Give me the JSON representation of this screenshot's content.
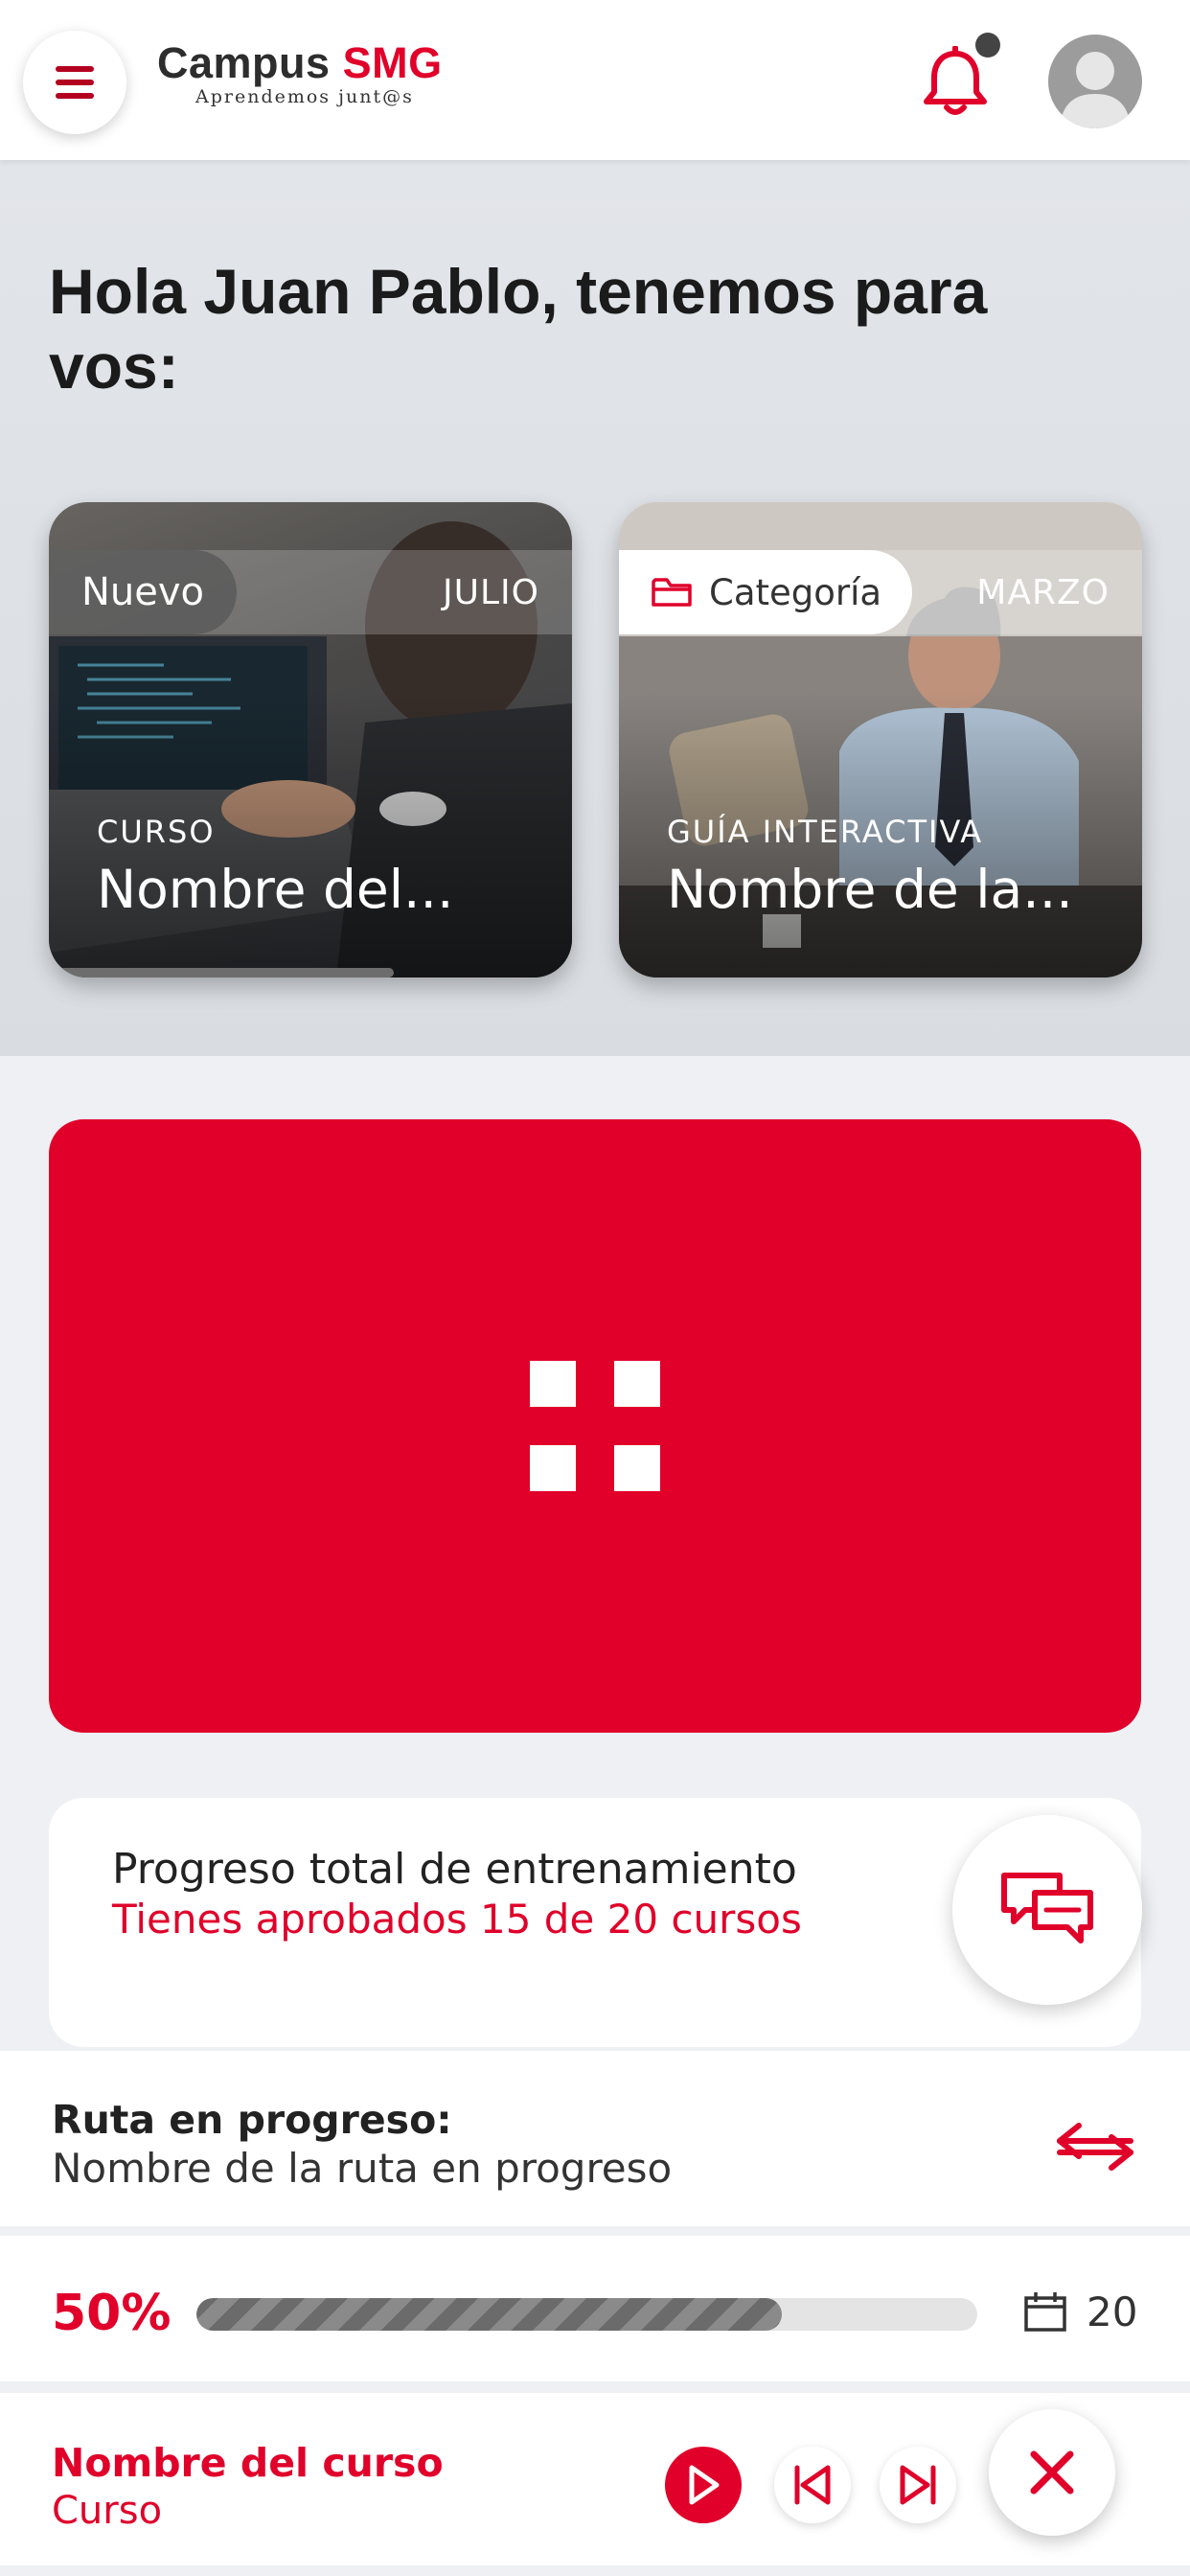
{
  "header": {
    "logo_main": "Campus",
    "logo_brand": "SMG",
    "logo_tagline": "Aprendemos junt@s",
    "icons": [
      "menu-icon",
      "bell-icon",
      "avatar-icon"
    ]
  },
  "greeting": "Hola Juan Pablo, tenemos para vos:",
  "cards": [
    {
      "badge": "Nuevo",
      "month": "JULIO",
      "type": "CURSO",
      "title": "Nombre del..."
    },
    {
      "badge": "Categoría",
      "month": "MARZO",
      "type": "GUÍA INTERACTIVA",
      "title": "Nombre de la..."
    }
  ],
  "banner": {
    "icon": "grid-icon",
    "color": "#e0002a"
  },
  "progress_card": {
    "title": "Progreso total de entrenamiento",
    "subtitle": "Tienes aprobados 15 de 20 cursos"
  },
  "route": {
    "label": "Ruta en progreso:",
    "name": "Nombre de la ruta en progreso"
  },
  "route_progress": {
    "percent_label": "50%",
    "fill_fraction": 0.75,
    "days": "20"
  },
  "player": {
    "course_name": "Nombre del curso",
    "course_type": "Curso"
  },
  "colors": {
    "accent": "#e0002a",
    "text": "#1d1d1f"
  }
}
